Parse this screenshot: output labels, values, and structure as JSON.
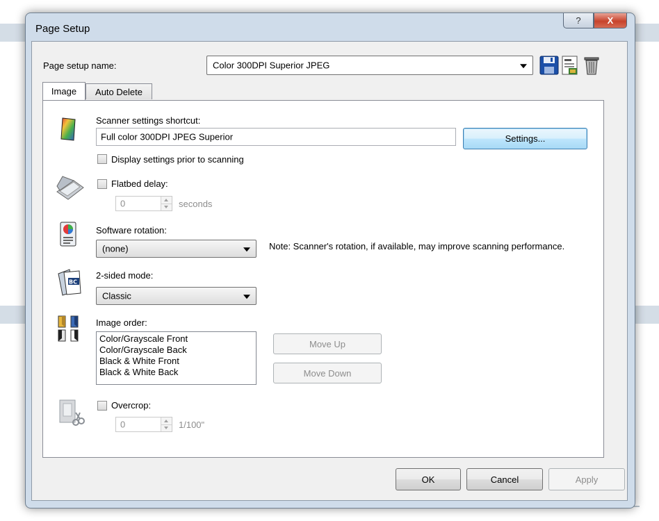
{
  "window": {
    "title": "Page Setup",
    "help_label": "?",
    "close_label": "X"
  },
  "page_setup": {
    "label": "Page setup name:",
    "value": "Color 300DPI Superior JPEG"
  },
  "tabs": [
    {
      "label": "Image"
    },
    {
      "label": "Auto Delete"
    }
  ],
  "scanner": {
    "label": "Scanner settings shortcut:",
    "value": "Full color 300DPI JPEG Superior",
    "settings_button": "Settings...",
    "display_prior_label": "Display settings prior to scanning"
  },
  "flatbed": {
    "label": "Flatbed delay:",
    "value": "0",
    "unit": "seconds"
  },
  "rotation": {
    "label": "Software rotation:",
    "value": "(none)",
    "note": "Note: Scanner's rotation, if available, may improve scanning performance."
  },
  "two_sided": {
    "label": "2-sided mode:",
    "value": "Classic"
  },
  "image_order": {
    "label": "Image order:",
    "items": [
      "Color/Grayscale Front",
      "Color/Grayscale Back",
      "Black & White Front",
      "Black & White Back"
    ],
    "move_up": "Move Up",
    "move_down": "Move Down"
  },
  "overcrop": {
    "label": "Overcrop:",
    "value": "0",
    "unit": "1/100\""
  },
  "footer": {
    "ok": "OK",
    "cancel": "Cancel",
    "apply": "Apply"
  }
}
